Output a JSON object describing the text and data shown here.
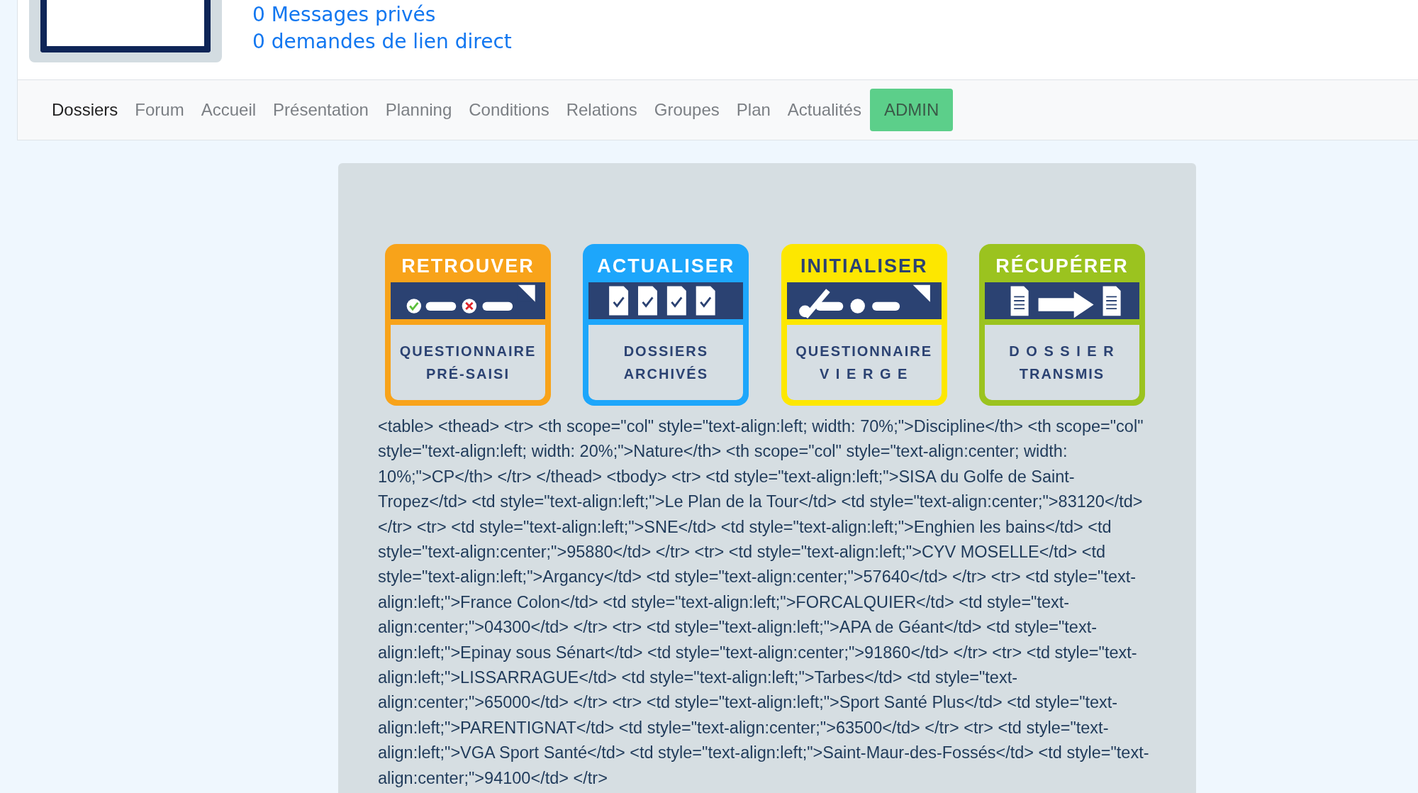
{
  "header": {
    "links": [
      "0 Messages privés",
      "0 demandes de lien direct"
    ]
  },
  "nav": {
    "items": [
      {
        "label": "Dossiers",
        "selected": true,
        "kind": "link"
      },
      {
        "label": "Forum",
        "selected": false,
        "kind": "link"
      },
      {
        "label": "Accueil",
        "selected": false,
        "kind": "link"
      },
      {
        "label": "Présentation",
        "selected": false,
        "kind": "link"
      },
      {
        "label": "Planning",
        "selected": false,
        "kind": "link"
      },
      {
        "label": "Conditions",
        "selected": false,
        "kind": "link"
      },
      {
        "label": "Relations",
        "selected": false,
        "kind": "link"
      },
      {
        "label": "Groupes",
        "selected": false,
        "kind": "link"
      },
      {
        "label": "Plan",
        "selected": false,
        "kind": "link"
      },
      {
        "label": "Actualités",
        "selected": false,
        "kind": "link"
      },
      {
        "label": "ADMIN",
        "selected": false,
        "kind": "button"
      }
    ]
  },
  "cards": [
    {
      "kind": "checklist",
      "title": "RETROUVER",
      "lines": [
        "QUESTIONNAIRE",
        "PRÉ-SAISI"
      ],
      "color": "#f8a31a"
    },
    {
      "kind": "documents",
      "title": "ACTUALISER",
      "lines": [
        "DOSSIERS",
        "ARCHIVÉS"
      ],
      "color": "#1da6fb"
    },
    {
      "kind": "pencil",
      "title": "INITIALISER",
      "lines": [
        "QUESTIONNAIRE",
        "V I E R G E"
      ],
      "color": "#fde700"
    },
    {
      "kind": "transfer",
      "title": "RÉCUPÉRER",
      "lines": [
        "D O S S I E R",
        "TRANSMIS"
      ],
      "color": "#9bc31f"
    }
  ],
  "body_text": "<table> <thead> <tr> <th scope=\"col\" style=\"text-align:left; width: 70%;\">Discipline</th> <th scope=\"col\" style=\"text-align:left; width: 20%;\">Nature</th> <th scope=\"col\" style=\"text-align:center; width: 10%;\">CP</th> </tr> </thead> <tbody> <tr> <td style=\"text-align:left;\">SISA du Golfe de Saint-Tropez</td> <td style=\"text-align:left;\">Le Plan de la Tour</td> <td style=\"text-align:center;\">83120</td> </tr> <tr> <td style=\"text-align:left;\">SNE</td> <td style=\"text-align:left;\">Enghien les bains</td> <td style=\"text-align:center;\">95880</td> </tr> <tr> <td style=\"text-align:left;\">CYV MOSELLE</td> <td style=\"text-align:left;\">Argancy</td> <td style=\"text-align:center;\">57640</td> </tr> <tr> <td style=\"text-align:left;\">France Colon</td> <td style=\"text-align:left;\">FORCALQUIER</td> <td style=\"text-align:center;\">04300</td> </tr> <tr> <td style=\"text-align:left;\">APA de Géant</td> <td style=\"text-align:left;\">Epinay sous Sénart</td> <td style=\"text-align:center;\">91860</td> </tr> <tr> <td style=\"text-align:left;\">LISSARRAGUE</td> <td style=\"text-align:left;\">Tarbes</td> <td style=\"text-align:center;\">65000</td> </tr> <tr> <td style=\"text-align:left;\">Sport Santé Plus</td> <td style=\"text-align:left;\">PARENTIGNAT</td> <td style=\"text-align:center;\">63500</td> </tr> <tr> <td style=\"text-align:left;\">VGA Sport Santé</td> <td style=\"text-align:left;\">Saint-Maur-des-Fossés</td> <td style=\"text-align:center;\">94100</td> </tr>"
}
